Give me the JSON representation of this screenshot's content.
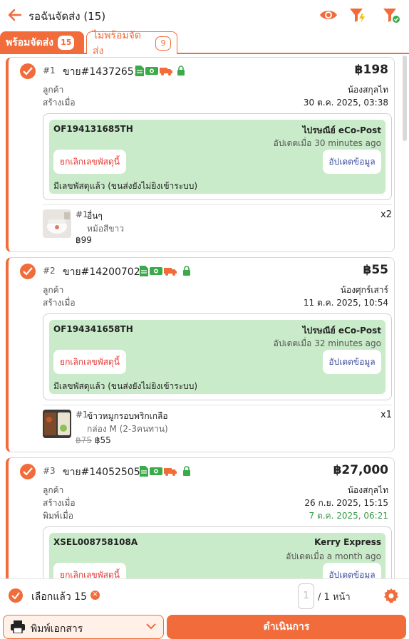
{
  "header": {
    "title": "รอฉันจัดส่ง (15)",
    "icons": [
      "back-arrow-icon",
      "eye-icon",
      "filter-bolt-icon",
      "filter-check-icon"
    ]
  },
  "tabs": [
    {
      "label": "พร้อมจัดส่ง",
      "count": "15",
      "active": true
    },
    {
      "label": "ไม่พร้อมจัดส่ง",
      "count": "9",
      "active": false
    }
  ],
  "orders": [
    {
      "index": "#1",
      "order_id": "ขาย#14372651",
      "price": "฿198",
      "customer_label": "ลูกค้า",
      "customer": "น้องสกุลไท",
      "created_label": "สร้างเมื่อ",
      "created": "30 ต.ค. 2025, 03:38",
      "shipment": {
        "tracking": "OF194131685TH",
        "carrier": "ไปรษณีย์ eCo-Post",
        "updated": "อัปเดตเมื่อ 30 minutes ago",
        "cancel_label": "ยกเลิกเลขพัสดุนี้",
        "update_label": "อัปเดตข้อมูล",
        "note": "มีเลขพัสดุแล้ว (ขนส่งยังไม่ยิงเข้าระบบ)"
      },
      "item": {
        "index": "#1",
        "name": "อื่นๆ",
        "variant": "หม้อสีขาว",
        "old_price": "",
        "price": "฿99",
        "qty": "x2"
      }
    },
    {
      "index": "#2",
      "order_id": "ขาย#14200702",
      "price": "฿55",
      "customer_label": "ลูกค้า",
      "customer": "น้องศุกร์เสาร์",
      "created_label": "สร้างเมื่อ",
      "created": "11 ต.ค. 2025, 10:54",
      "shipment": {
        "tracking": "OF194341658TH",
        "carrier": "ไปรษณีย์ eCo-Post",
        "updated": "อัปเดตเมื่อ 32 minutes ago",
        "cancel_label": "ยกเลิกเลขพัสดุนี้",
        "update_label": "อัปเดตข้อมูล",
        "note": "มีเลขพัสดุแล้ว (ขนส่งยังไม่ยิงเข้าระบบ)"
      },
      "item": {
        "index": "#1",
        "name": "ข้าวหมูกรอบพริกเกลือ",
        "variant": "กล่อง M (2-3คนทาน)",
        "old_price": "฿75",
        "price": "฿55",
        "qty": "x1"
      }
    },
    {
      "index": "#3",
      "order_id": "ขาย#14052505",
      "price": "฿27,000",
      "customer_label": "ลูกค้า",
      "customer": "น้องสกุลไท",
      "created_label": "สร้างเมื่อ",
      "created": "26 ก.ย. 2025, 15:15",
      "printed_label": "พิมพ์เมื่อ",
      "printed": "7 ต.ค. 2025, 06:21",
      "shipment": {
        "tracking": "XSEL008758108A",
        "carrier": "Kerry Express",
        "updated": "อัปเดตเมื่อ a month ago",
        "cancel_label": "ยกเลิกเลขพัสดุนี้",
        "update_label": "อัปเดตข้อมูล"
      }
    }
  ],
  "footer": {
    "selected_label": "เลือกแล้ว 15",
    "page_current": "1",
    "page_total": "/ 1 หน้า",
    "print_label": "พิมพ์เอกสาร",
    "proceed_label": "ดำเนินการ"
  },
  "colors": {
    "accent": "#f26b3a",
    "ship_bg": "#c9ebc9",
    "cancel": "#e53935",
    "update": "#3c4c9c",
    "printed": "#3a9a4a"
  }
}
